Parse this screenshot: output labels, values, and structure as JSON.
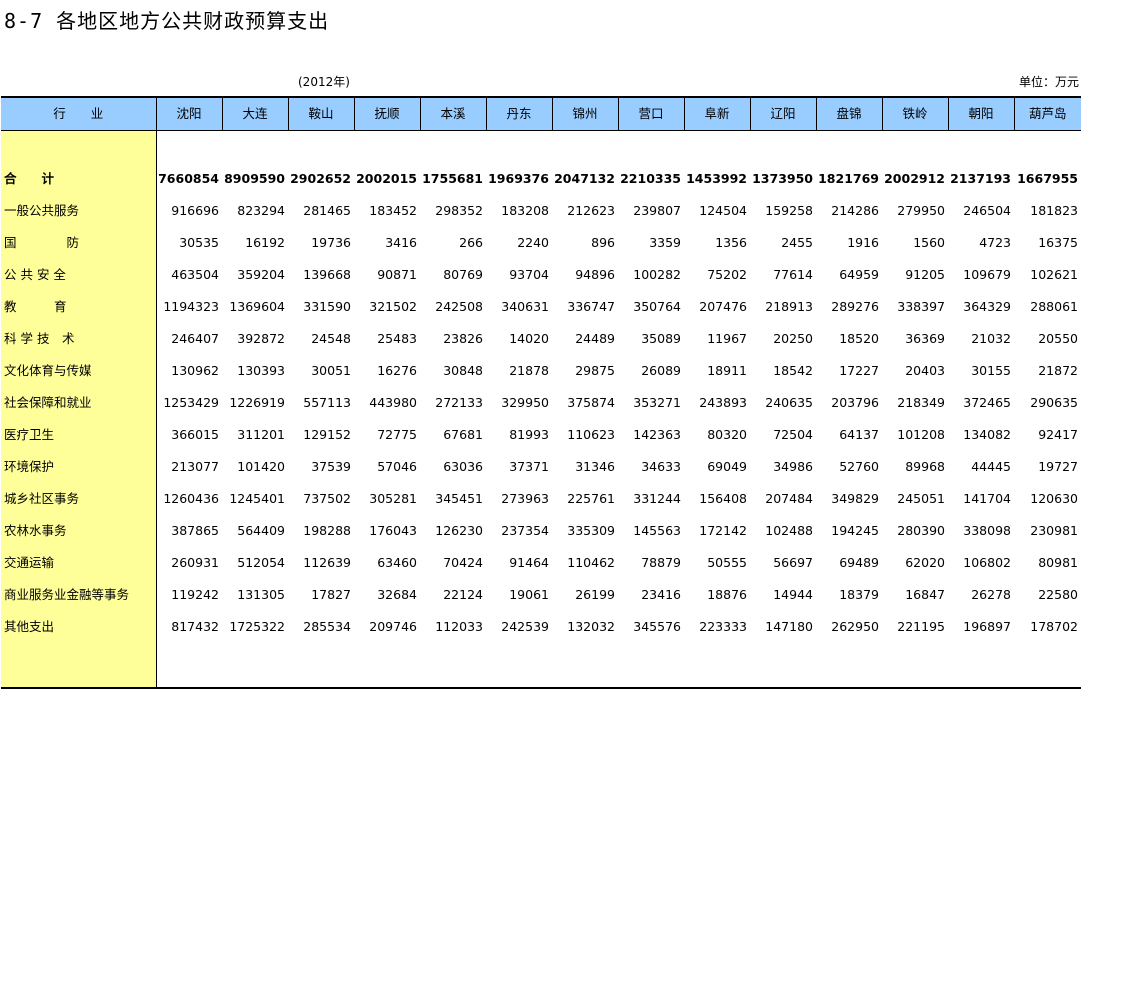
{
  "title": "8-7   各地区地方公共财政预算支出",
  "year_note": "(2012年)",
  "unit_note": "单位：万元",
  "header": {
    "row_label": "行　　业",
    "cities": [
      "沈阳",
      "大连",
      "鞍山",
      "抚顺",
      "本溪",
      "丹东",
      "锦州",
      "营口",
      "阜新",
      "辽阳",
      "盘锦",
      "铁岭",
      "朝阳",
      "葫芦岛"
    ]
  },
  "rows": [
    {
      "label": "合　　计",
      "bold": true,
      "values": [
        "7660854",
        "8909590",
        "2902652",
        "2002015",
        "1755681",
        "1969376",
        "2047132",
        "2210335",
        "1453992",
        "1373950",
        "1821769",
        "2002912",
        "2137193",
        "1667955"
      ]
    },
    {
      "label": "一般公共服务",
      "values": [
        "916696",
        "823294",
        "281465",
        "183452",
        "298352",
        "183208",
        "212623",
        "239807",
        "124504",
        "159258",
        "214286",
        "279950",
        "246504",
        "181823"
      ]
    },
    {
      "label": "国　　　　防",
      "values": [
        "30535",
        "16192",
        "19736",
        "3416",
        "266",
        "2240",
        "896",
        "3359",
        "1356",
        "2455",
        "1916",
        "1560",
        "4723",
        "16375"
      ]
    },
    {
      "label": "公 共 安 全",
      "values": [
        "463504",
        "359204",
        "139668",
        "90871",
        "80769",
        "93704",
        "94896",
        "100282",
        "75202",
        "77614",
        "64959",
        "91205",
        "109679",
        "102621"
      ]
    },
    {
      "label": "教　　　育",
      "values": [
        "1194323",
        "1369604",
        "331590",
        "321502",
        "242508",
        "340631",
        "336747",
        "350764",
        "207476",
        "218913",
        "289276",
        "338397",
        "364329",
        "288061"
      ]
    },
    {
      "label": "科 学 技　术",
      "values": [
        "246407",
        "392872",
        "24548",
        "25483",
        "23826",
        "14020",
        "24489",
        "35089",
        "11967",
        "20250",
        "18520",
        "36369",
        "21032",
        "20550"
      ]
    },
    {
      "label": "文化体育与传媒",
      "values": [
        "130962",
        "130393",
        "30051",
        "16276",
        "30848",
        "21878",
        "29875",
        "26089",
        "18911",
        "18542",
        "17227",
        "20403",
        "30155",
        "21872"
      ]
    },
    {
      "label": "社会保障和就业",
      "values": [
        "1253429",
        "1226919",
        "557113",
        "443980",
        "272133",
        "329950",
        "375874",
        "353271",
        "243893",
        "240635",
        "203796",
        "218349",
        "372465",
        "290635"
      ]
    },
    {
      "label": "医疗卫生",
      "values": [
        "366015",
        "311201",
        "129152",
        "72775",
        "67681",
        "81993",
        "110623",
        "142363",
        "80320",
        "72504",
        "64137",
        "101208",
        "134082",
        "92417"
      ]
    },
    {
      "label": "环境保护",
      "values": [
        "213077",
        "101420",
        "37539",
        "57046",
        "63036",
        "37371",
        "31346",
        "34633",
        "69049",
        "34986",
        "52760",
        "89968",
        "44445",
        "19727"
      ]
    },
    {
      "label": "城乡社区事务",
      "values": [
        "1260436",
        "1245401",
        "737502",
        "305281",
        "345451",
        "273963",
        "225761",
        "331244",
        "156408",
        "207484",
        "349829",
        "245051",
        "141704",
        "120630"
      ]
    },
    {
      "label": "农林水事务",
      "values": [
        "387865",
        "564409",
        "198288",
        "176043",
        "126230",
        "237354",
        "335309",
        "145563",
        "172142",
        "102488",
        "194245",
        "280390",
        "338098",
        "230981"
      ]
    },
    {
      "label": "交通运输",
      "values": [
        "260931",
        "512054",
        "112639",
        "63460",
        "70424",
        "91464",
        "110462",
        "78879",
        "50555",
        "56697",
        "69489",
        "62020",
        "106802",
        "80981"
      ]
    },
    {
      "label": "商业服务业金融等事务",
      "values": [
        "119242",
        "131305",
        "17827",
        "32684",
        "22124",
        "19061",
        "26199",
        "23416",
        "18876",
        "14944",
        "18379",
        "16847",
        "26278",
        "22580"
      ]
    },
    {
      "label": "其他支出",
      "values": [
        "817432",
        "1725322",
        "285534",
        "209746",
        "112033",
        "242539",
        "132032",
        "345576",
        "223333",
        "147180",
        "262950",
        "221195",
        "196897",
        "178702"
      ]
    }
  ]
}
